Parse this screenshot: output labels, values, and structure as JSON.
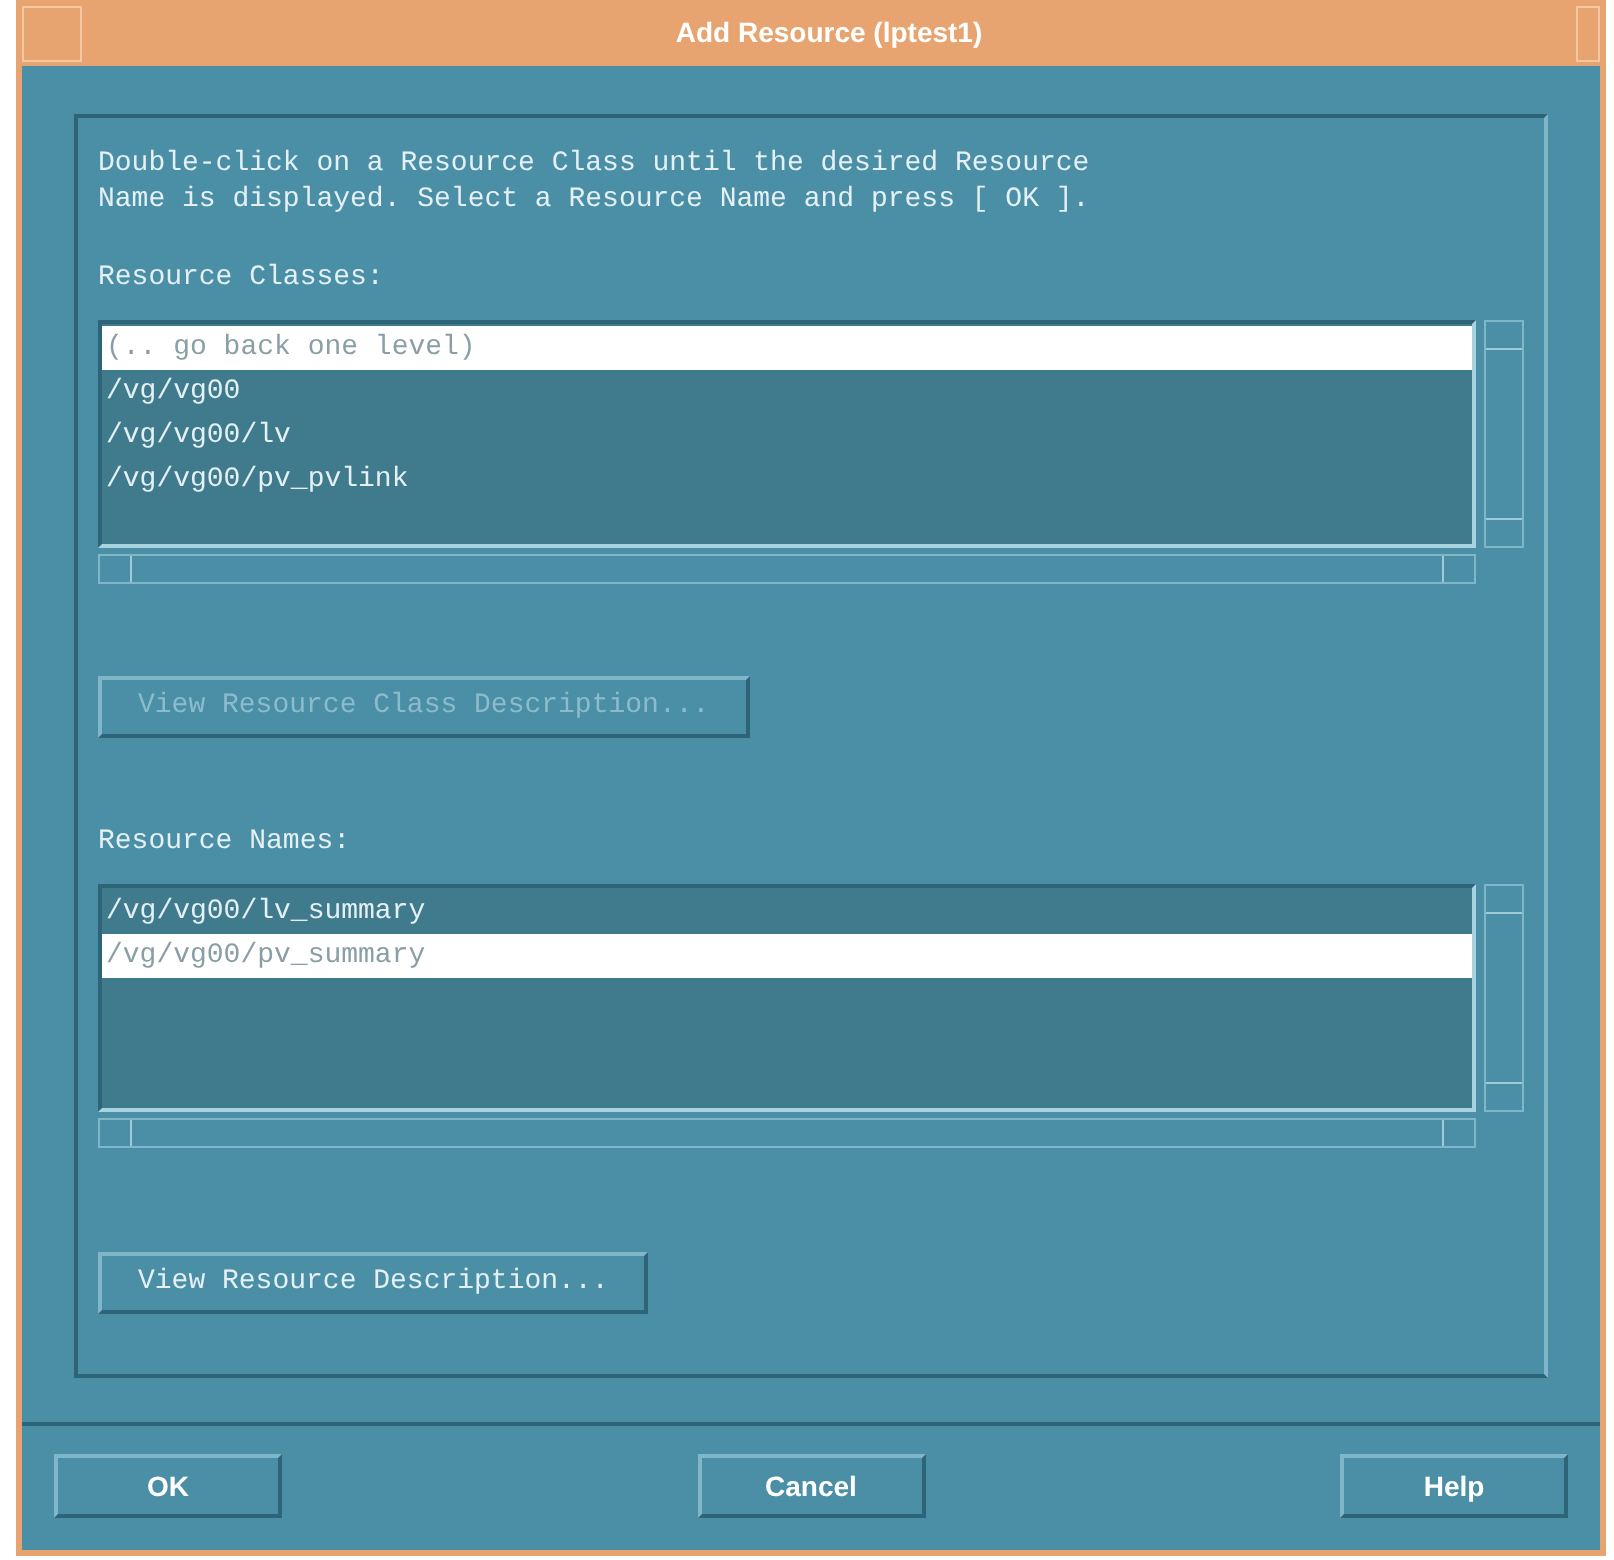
{
  "window": {
    "title": "Add Resource (lptest1)"
  },
  "instructions": "Double-click on a Resource Class until the desired Resource\nName is displayed. Select a Resource Name and press [ OK ].",
  "classes": {
    "label": "Resource Classes:",
    "items": [
      {
        "text": "(.. go back one level)",
        "selected": true
      },
      {
        "text": "/vg/vg00",
        "selected": false
      },
      {
        "text": "/vg/vg00/lv",
        "selected": false
      },
      {
        "text": "/vg/vg00/pv_pvlink",
        "selected": false
      }
    ],
    "button": {
      "label": "View Resource Class Description...",
      "disabled": true
    }
  },
  "names": {
    "label": "Resource Names:",
    "items": [
      {
        "text": "/vg/vg00/lv_summary",
        "selected": false
      },
      {
        "text": "/vg/vg00/pv_summary",
        "selected": true
      }
    ],
    "button": {
      "label": "View Resource Description...",
      "disabled": false
    }
  },
  "buttons": [
    "OK",
    "Cancel",
    "Help"
  ]
}
